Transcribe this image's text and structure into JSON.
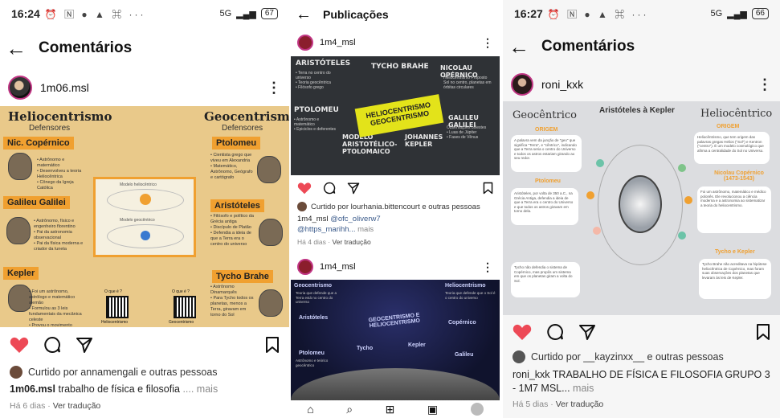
{
  "panel1": {
    "status_time": "16:24",
    "status_icons": "⏰ 🄽 ● ▲ ⌘ ···",
    "battery": "67",
    "signal": "5G",
    "title": "Comentários",
    "username": "1m06.msl",
    "slide": {
      "left_title": "Heliocentrismo",
      "left_sub": "Defensores",
      "right_title": "Geocentrismo",
      "right_sub": "Defensores",
      "tags": [
        "Nic. Copérnico",
        "Galileu Galilei",
        "Kepler",
        "Ptolomeu",
        "Aristóteles",
        "Tycho Brahe"
      ],
      "center_top": "Modelo heliocêntrico",
      "center_bottom": "Modelo geocêntrico",
      "qr_question": "O que é ?",
      "qr_left": "Heliocentrismo",
      "qr_right": "Geocentrismo"
    },
    "liked_by": "Curtido por annamengali e outras pessoas",
    "caption_user": "1m06.msl",
    "caption_text": "trabalho de física e filosofia",
    "caption_more": ".... mais",
    "time_ago": "Há 6 dias",
    "translate": "Ver tradução"
  },
  "panel2": {
    "title": "Publicações",
    "post1_user": "1m4_msl",
    "slide": {
      "names": [
        "ARISTÓTELES",
        "TYCHO BRAHE",
        "NICOLAU OPÉRNICO",
        "PTOLOMEU",
        "JOHANNES KEPLER",
        "GALILEU GALILEI",
        "MODELO ARISTOTÉLICO-PTOLOMAICO"
      ],
      "banner_top": "HELIOCENTRISMO",
      "banner_bottom": "GEOCENTRISMO"
    },
    "liked_by": "Curtido por lourhania.bittencourt e outras pessoas",
    "caption_user": "1m4_msl",
    "caption_text": "@ofc_oliverw7",
    "caption_text2": "@https_marihh...",
    "caption_more": "mais",
    "time_ago": "Há 4 dias",
    "translate": "Ver tradução",
    "post2_user": "1m4_msl",
    "slide2": {
      "left": "Geocentrismo",
      "right": "Heliocentrismo",
      "center": "GEOCENTRISMO E HELIOCENTRISMO",
      "names": [
        "Aristóteles",
        "Ptolomeu",
        "Tycho",
        "Kepler",
        "Copérnico",
        "Galileu"
      ]
    }
  },
  "panel3": {
    "status_time": "16:27",
    "status_icons": "⏰ 🄽 ● ▲ ⌘ ···",
    "battery": "66",
    "signal": "5G",
    "title": "Comentários",
    "username": "roni_kxk",
    "slide": {
      "left_title": "Geocêntrico",
      "center_title": "Aristóteles à Kepler",
      "right_title": "Heliocêntrico",
      "origem_left": "ORIGEM",
      "origem_right": "ORIGEM",
      "ptolomeu": "Ptolomeu",
      "copernico": "Nicolau Copérnico (1473-1543)",
      "tycho": "Tycho e Kepler"
    },
    "liked_by": "Curtido por __kayzinxx__ e outras pessoas",
    "caption_user": "roni_kxk",
    "caption_text": "TRABALHO DE FÍSICA E FILOSOFIA GRUPO 3 - 1M7 MSL...",
    "caption_more": "mais",
    "time_ago": "Há 5 dias",
    "translate": "Ver tradução"
  },
  "colors": {
    "like_red": "#ed4956",
    "slide1_bg": "#e9c98a",
    "accent_orange": "#f0a030"
  }
}
